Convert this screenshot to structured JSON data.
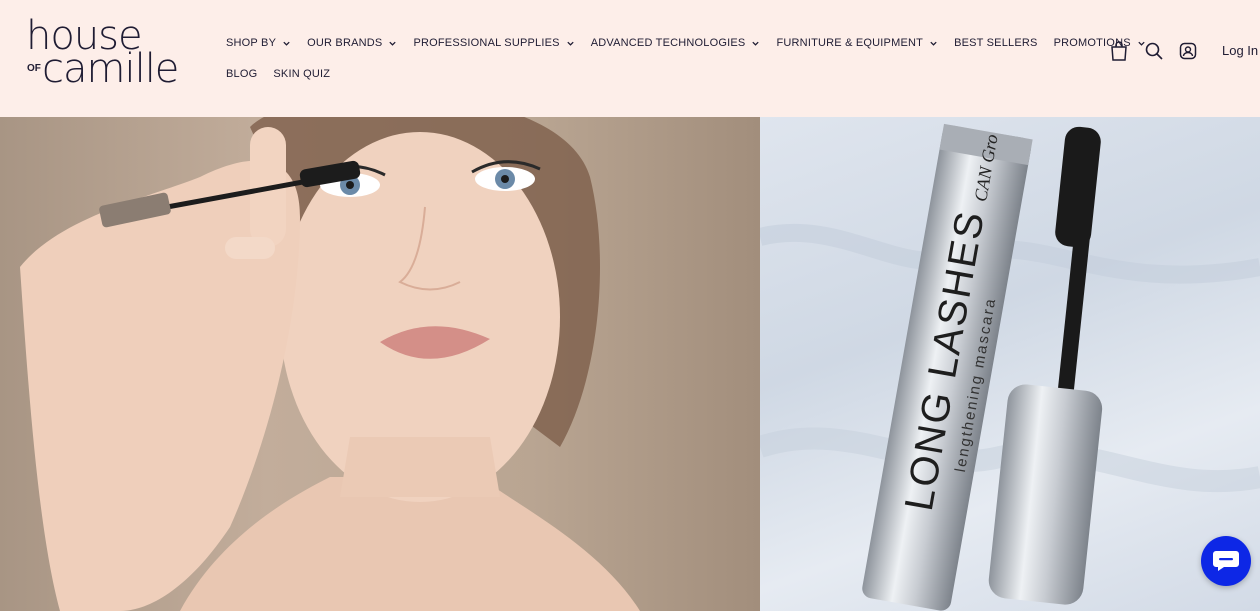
{
  "brand": {
    "line1": "house",
    "line2": "camille",
    "of": "OF"
  },
  "nav": {
    "row1": [
      {
        "label": "SHOP BY",
        "dropdown": true
      },
      {
        "label": "OUR BRANDS",
        "dropdown": true
      },
      {
        "label": "PROFESSIONAL SUPPLIES",
        "dropdown": true
      },
      {
        "label": "ADVANCED TECHNOLOGIES",
        "dropdown": true
      },
      {
        "label": "FURNITURE & EQUIPMENT",
        "dropdown": true
      },
      {
        "label": "BEST SELLERS",
        "dropdown": false
      },
      {
        "label": "PROMOTIONS",
        "dropdown": true
      }
    ],
    "row2": [
      {
        "label": "BLOG",
        "dropdown": false
      },
      {
        "label": "SKIN QUIZ",
        "dropdown": false
      }
    ]
  },
  "header_icons": [
    "bag-icon",
    "search-icon",
    "account-icon"
  ],
  "login_label": "Log In",
  "hero": {
    "left_image": "woman-applying-mascara",
    "right_image": "long-lashes-mascara-product",
    "product_brand": "CAN Gro",
    "product_name": "LONG LASHES",
    "product_sub": "lengthening mascara"
  },
  "chat_icon": "chat-bubble-icon",
  "colors": {
    "header_bg": "#fdeee9",
    "text": "#1f1c33",
    "chat": "#0d27e6"
  }
}
